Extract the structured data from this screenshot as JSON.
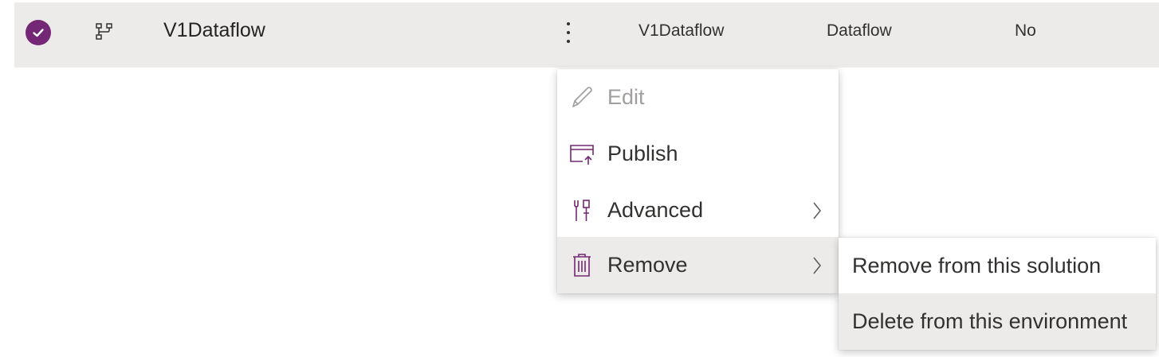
{
  "row": {
    "name": "V1Dataflow",
    "col_name": "V1Dataflow",
    "col_type": "Dataflow",
    "col_managed": "No",
    "selected": true
  },
  "icons": {
    "check": "checkmark-circle-icon",
    "row_type": "dataflow-icon",
    "more": "more-vertical-icon",
    "edit": "pencil-icon",
    "publish": "publish-icon",
    "advanced": "tools-icon",
    "remove": "trash-icon",
    "chevron": "chevron-right-icon"
  },
  "context_menu": {
    "items": [
      {
        "label": "Edit",
        "disabled": true
      },
      {
        "label": "Publish"
      },
      {
        "label": "Advanced",
        "has_submenu": true
      },
      {
        "label": "Remove",
        "has_submenu": true,
        "active": true
      }
    ]
  },
  "submenu": {
    "items": [
      {
        "label": "Remove from this solution"
      },
      {
        "label": "Delete from this environment",
        "hovered": true
      }
    ]
  },
  "colors": {
    "accent": "#742774",
    "row_selected_bg": "#edebe9",
    "disabled_text": "#a19f9d"
  }
}
